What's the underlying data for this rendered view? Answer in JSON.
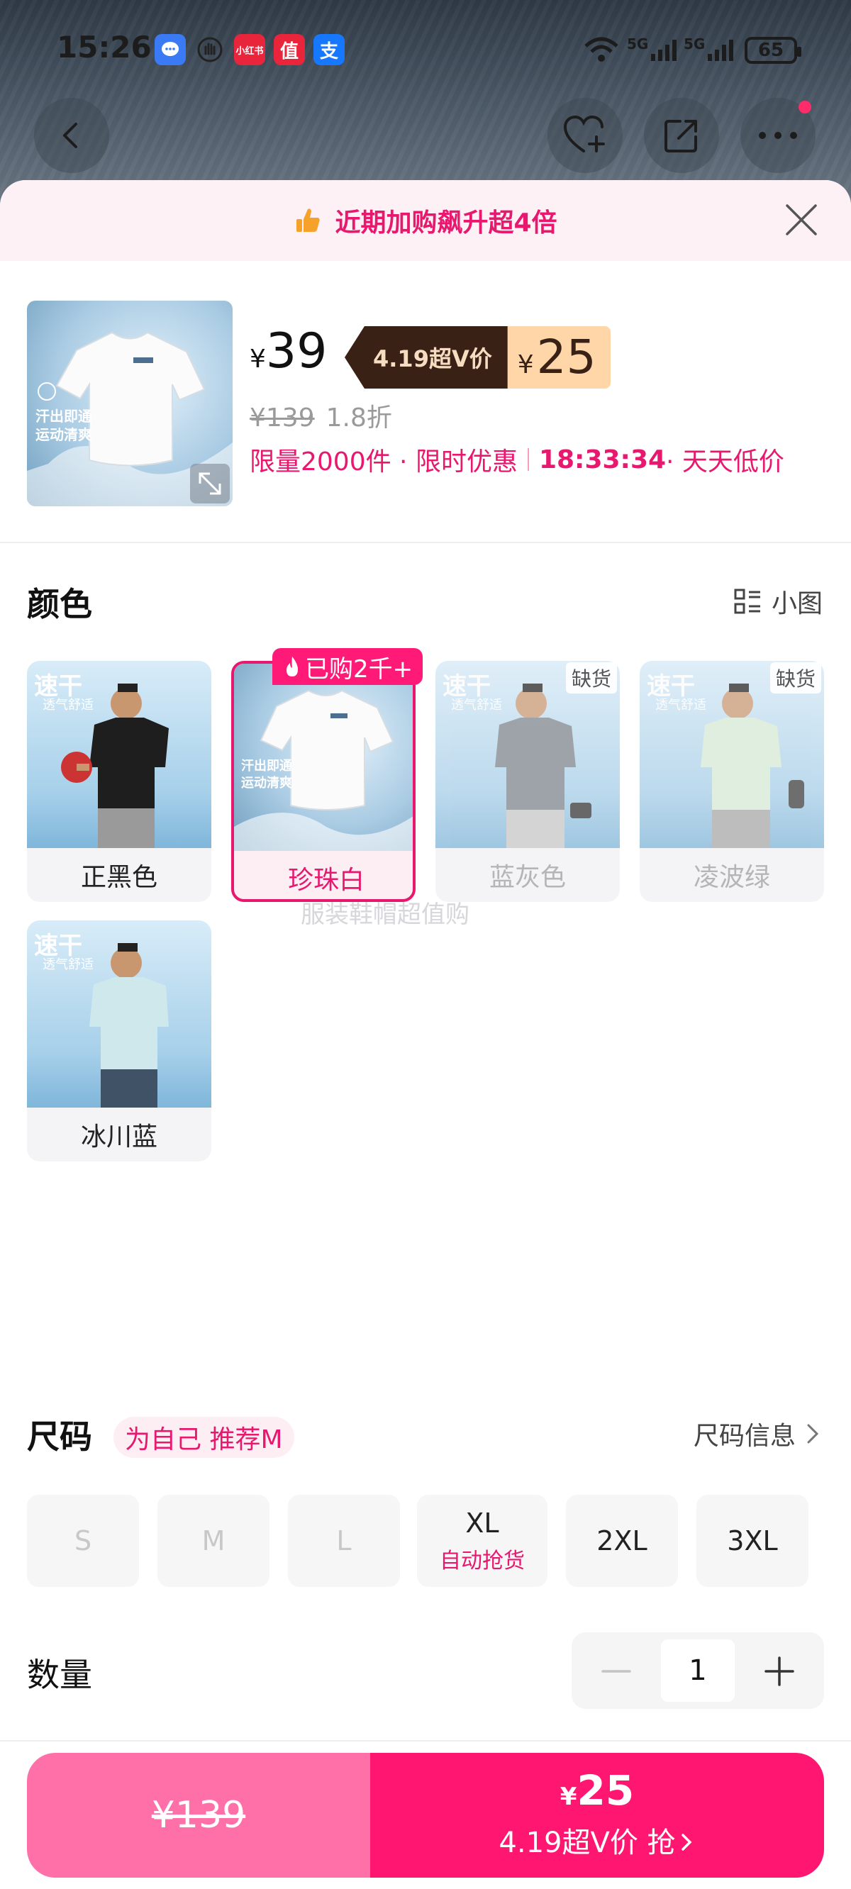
{
  "status_bar": {
    "time": "15:26",
    "apps": [
      {
        "name": "message-app-icon",
        "glyph": "💬",
        "color": "#3a7bf5"
      },
      {
        "name": "hand-app-icon",
        "glyph": "✋",
        "color": "#333333"
      },
      {
        "name": "xiaohongshu-app-icon",
        "glyph": "小红书",
        "color": "#e8253b"
      },
      {
        "name": "zhide-app-icon",
        "glyph": "值",
        "color": "#e8253b"
      },
      {
        "name": "alipay-app-icon",
        "glyph": "支",
        "color": "#1677ff"
      }
    ],
    "signal_1": "5G",
    "signal_2": "5G",
    "battery": "65"
  },
  "banner": {
    "text": "近期加购飙升超4倍"
  },
  "product": {
    "price": "39",
    "yen": "¥",
    "vip_label": "4.19超V价",
    "vip_price": "25",
    "original_price": "¥139",
    "discount": "1.8折",
    "limit_text": "限量2000件 · 限时优惠",
    "countdown": "18:33:34",
    "daily_low": " · 天天低价"
  },
  "color_section": {
    "title": "颜色",
    "view_toggle": "小图",
    "hot_tag": "已购2千+",
    "out_of_stock": "缺货",
    "colors": [
      {
        "label": "正黑色",
        "state": "normal",
        "shirt": "#1e1e1e"
      },
      {
        "label": "珍珠白",
        "state": "selected",
        "shirt": "#fbfbfb"
      },
      {
        "label": "蓝灰色",
        "state": "oos",
        "shirt": "#7c858c"
      },
      {
        "label": "凌波绿",
        "state": "oos",
        "shirt": "#d8ecd6"
      },
      {
        "label": "冰川蓝",
        "state": "normal",
        "shirt": "#cfe8ec"
      }
    ],
    "card_text": "速干",
    "card_sub": "透气舒适",
    "product_card_text_1": "汗出即通",
    "product_card_text_2": "运动清爽"
  },
  "watermark": "服装鞋帽超值购",
  "size_section": {
    "title": "尺码",
    "recommend": "为自己 推荐M",
    "info": "尺码信息",
    "sizes": [
      {
        "label": "S",
        "state": "disabled",
        "sub": ""
      },
      {
        "label": "M",
        "state": "disabled",
        "sub": ""
      },
      {
        "label": "L",
        "state": "disabled",
        "sub": ""
      },
      {
        "label": "XL",
        "state": "normal",
        "sub": "自动抢货"
      },
      {
        "label": "2XL",
        "state": "normal",
        "sub": ""
      },
      {
        "label": "3XL",
        "state": "normal",
        "sub": ""
      }
    ]
  },
  "quantity": {
    "title": "数量",
    "value": "1"
  },
  "buy_bar": {
    "left_price": "¥139",
    "right_yen": "¥",
    "right_price": "25",
    "right_text": "4.19超V价 抢"
  },
  "accent_color": "#e8186e"
}
